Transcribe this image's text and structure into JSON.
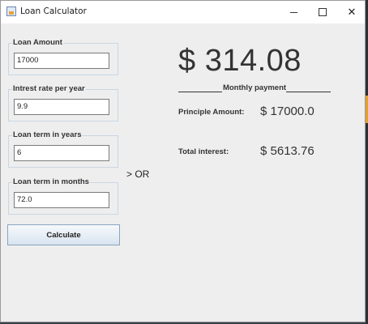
{
  "window": {
    "title": "Loan Calculator"
  },
  "inputs": {
    "loan_amount": {
      "label": "Loan Amount",
      "value": "17000"
    },
    "interest_rate": {
      "label": "Intrest rate per year",
      "value": "9.9"
    },
    "term_years": {
      "label": "Loan term in years",
      "value": "6"
    },
    "term_months": {
      "label": "Loan term in months",
      "value": "72.0"
    }
  },
  "or_text": "> OR",
  "calculate_label": "Calculate",
  "results": {
    "monthly_payment": "$ 314.08",
    "monthly_caption": "Monthly payment",
    "principal_label": "Principle Amount:",
    "principal_value": "$ 17000.0",
    "interest_label": "Total interest:",
    "interest_value": "$ 5613.76"
  },
  "colors": {
    "window_bg": "#eeeeee",
    "group_border": "#c9d6e3",
    "desktop_accent": "#e3a22a"
  }
}
